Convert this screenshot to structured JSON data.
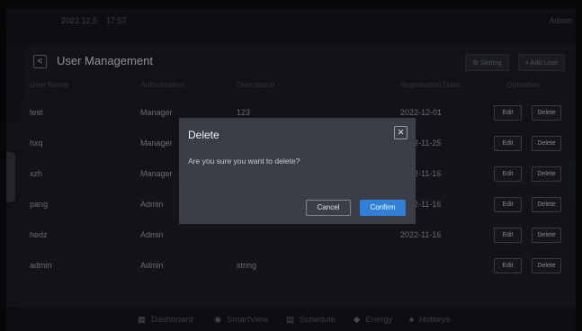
{
  "topbar": {
    "date": "2022.12.5",
    "time": "17:57",
    "user": "Admin"
  },
  "page": {
    "title": "User Management",
    "back_icon": "<",
    "setting_label": "⚙ Setting",
    "add_user_label": "+ Add User"
  },
  "table": {
    "headers": [
      "User Name",
      "Authorization",
      "Description",
      "Registration Date",
      "Operation"
    ],
    "rows": [
      {
        "name": "test",
        "auth": "Manager",
        "desc": "123",
        "date": "2022-12-01"
      },
      {
        "name": "hxq",
        "auth": "Manager",
        "desc": "",
        "date": "2022-11-25"
      },
      {
        "name": "xzh",
        "auth": "Manager",
        "desc": "",
        "date": "2022-11-16"
      },
      {
        "name": "pang",
        "auth": "Admin",
        "desc": "",
        "date": "2022-11-16"
      },
      {
        "name": "hedz",
        "auth": "Admin",
        "desc": "",
        "date": "2022-11-16"
      },
      {
        "name": "admin",
        "auth": "Admin",
        "desc": "string",
        "date": ""
      }
    ],
    "edit_label": "Edit",
    "delete_label": "Delete"
  },
  "navbar": {
    "items": [
      {
        "icon": "▦",
        "icon_name": "dashboard-icon",
        "label": "Dashboard"
      },
      {
        "icon": "◉",
        "icon_name": "smartview-icon",
        "label": "SmartView"
      },
      {
        "icon": "▤",
        "icon_name": "schedule-icon",
        "label": "Schedule"
      },
      {
        "icon": "◆",
        "icon_name": "energy-icon",
        "label": "Energy"
      },
      {
        "icon": "♠",
        "icon_name": "hotkeys-icon",
        "label": "Hotkeys"
      }
    ]
  },
  "dialog": {
    "title": "Delete",
    "close_icon": "✕",
    "message": "Are you sure you want to delete?",
    "cancel_label": "Cancel",
    "confirm_label": "Confirm"
  },
  "colors": {
    "accent": "#2f80d6",
    "background": "#1a1d25",
    "dialog": "#3b3e46"
  }
}
